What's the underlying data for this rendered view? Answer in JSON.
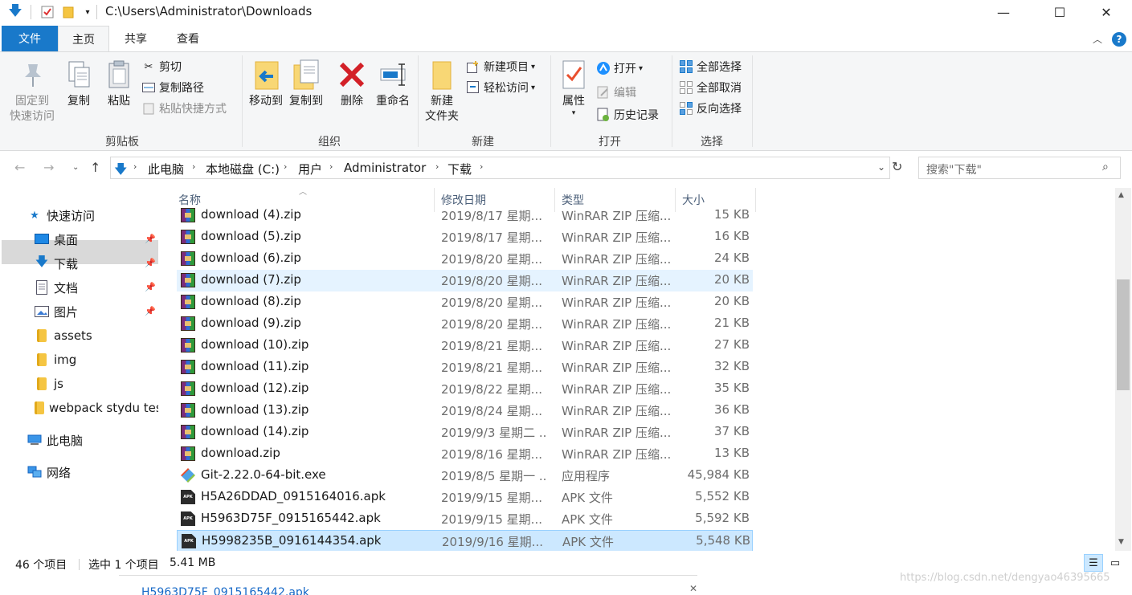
{
  "window": {
    "title": "C:\\Users\\Administrator\\Downloads",
    "minimize": "—",
    "maximize": "☐",
    "close": "✕"
  },
  "ribbon_tabs": [
    "文件",
    "主页",
    "共享",
    "查看"
  ],
  "ribbon": {
    "clipboard": {
      "label": "剪贴板",
      "pin": "固定到\n快速访问",
      "pin_l1": "固定到",
      "pin_l2": "快速访问",
      "copy": "复制",
      "paste": "粘贴",
      "cut": "剪切",
      "copy_path": "复制路径",
      "paste_shortcut": "粘贴快捷方式"
    },
    "organize": {
      "label": "组织",
      "move_to": "移动到",
      "copy_to": "复制到",
      "delete": "删除",
      "rename": "重命名"
    },
    "new": {
      "label": "新建",
      "new_folder_l1": "新建",
      "new_folder_l2": "文件夹",
      "new_item": "新建项目",
      "easy_access": "轻松访问"
    },
    "open": {
      "label": "打开",
      "properties": "属性",
      "open": "打开",
      "edit": "编辑",
      "history": "历史记录"
    },
    "select": {
      "label": "选择",
      "select_all": "全部选择",
      "select_none": "全部取消",
      "invert": "反向选择"
    }
  },
  "breadcrumb": [
    "此电脑",
    "本地磁盘 (C:)",
    "用户",
    "Administrator",
    "下载"
  ],
  "search": {
    "placeholder": "搜索\"下载\""
  },
  "nav": {
    "quick_access": "快速访问",
    "desktop": "桌面",
    "downloads": "下载",
    "documents": "文档",
    "pictures": "图片",
    "assets": "assets",
    "img": "img",
    "js": "js",
    "webpack": "webpack stydu tes",
    "this_pc": "此电脑",
    "network": "网络"
  },
  "columns": {
    "name": "名称",
    "date": "修改日期",
    "type": "类型",
    "size": "大小"
  },
  "files": [
    {
      "name": "download (4).zip",
      "date": "2019/8/17 星期...",
      "type": "WinRAR ZIP 压缩...",
      "size": "15 KB",
      "icon": "rar"
    },
    {
      "name": "download (5).zip",
      "date": "2019/8/17 星期...",
      "type": "WinRAR ZIP 压缩...",
      "size": "16 KB",
      "icon": "rar"
    },
    {
      "name": "download (6).zip",
      "date": "2019/8/20 星期...",
      "type": "WinRAR ZIP 压缩...",
      "size": "24 KB",
      "icon": "rar"
    },
    {
      "name": "download (7).zip",
      "date": "2019/8/20 星期...",
      "type": "WinRAR ZIP 压缩...",
      "size": "20 KB",
      "icon": "rar"
    },
    {
      "name": "download (8).zip",
      "date": "2019/8/20 星期...",
      "type": "WinRAR ZIP 压缩...",
      "size": "20 KB",
      "icon": "rar"
    },
    {
      "name": "download (9).zip",
      "date": "2019/8/20 星期...",
      "type": "WinRAR ZIP 压缩...",
      "size": "21 KB",
      "icon": "rar"
    },
    {
      "name": "download (10).zip",
      "date": "2019/8/21 星期...",
      "type": "WinRAR ZIP 压缩...",
      "size": "27 KB",
      "icon": "rar"
    },
    {
      "name": "download (11).zip",
      "date": "2019/8/21 星期...",
      "type": "WinRAR ZIP 压缩...",
      "size": "32 KB",
      "icon": "rar"
    },
    {
      "name": "download (12).zip",
      "date": "2019/8/22 星期...",
      "type": "WinRAR ZIP 压缩...",
      "size": "35 KB",
      "icon": "rar"
    },
    {
      "name": "download (13).zip",
      "date": "2019/8/24 星期...",
      "type": "WinRAR ZIP 压缩...",
      "size": "36 KB",
      "icon": "rar"
    },
    {
      "name": "download (14).zip",
      "date": "2019/9/3 星期二 ...",
      "type": "WinRAR ZIP 压缩...",
      "size": "37 KB",
      "icon": "rar"
    },
    {
      "name": "download.zip",
      "date": "2019/8/16 星期...",
      "type": "WinRAR ZIP 压缩...",
      "size": "13 KB",
      "icon": "rar"
    },
    {
      "name": "Git-2.22.0-64-bit.exe",
      "date": "2019/8/5 星期一 ...",
      "type": "应用程序",
      "size": "45,984 KB",
      "icon": "git"
    },
    {
      "name": "H5A26DDAD_0915164016.apk",
      "date": "2019/9/15 星期...",
      "type": "APK 文件",
      "size": "5,552 KB",
      "icon": "apk"
    },
    {
      "name": "H5963D75F_0915165442.apk",
      "date": "2019/9/15 星期...",
      "type": "APK 文件",
      "size": "5,592 KB",
      "icon": "apk"
    },
    {
      "name": "H5998235B_0916144354.apk",
      "date": "2019/9/16 星期...",
      "type": "APK 文件",
      "size": "5,548 KB",
      "icon": "apk"
    }
  ],
  "hover_row": 3,
  "selected_row": 15,
  "status": {
    "count": "46 个项目",
    "selected": "选中 1 个项目",
    "size": "5.41 MB"
  },
  "bottom": {
    "file_link": "H5963D75F_0915165442.apk",
    "watermark": "https://blog.csdn.net/dengyao46395665"
  },
  "colors": {
    "accent": "#1979ca",
    "selected_bg": "#cce8ff",
    "hover_bg": "#e5f3ff"
  }
}
